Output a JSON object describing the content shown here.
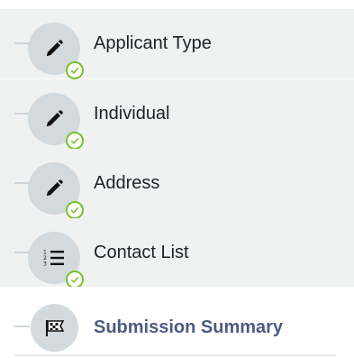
{
  "steps": [
    {
      "label": "Applicant Type",
      "icon": "pencil-icon",
      "status": "completed"
    },
    {
      "label": "Individual",
      "icon": "pencil-icon",
      "status": "completed"
    },
    {
      "label": "Address",
      "icon": "pencil-icon",
      "status": "completed"
    },
    {
      "label": "Contact List",
      "icon": "numbered-list-icon",
      "status": "completed"
    },
    {
      "label": "Submission Summary",
      "icon": "checkered-flag-icon",
      "status": "current"
    }
  ],
  "colors": {
    "completed_row_bg": "#f0f2f2",
    "circle_bg": "#d2dadd",
    "check_green": "#7bbf2f",
    "current_label": "#4d5b82"
  }
}
